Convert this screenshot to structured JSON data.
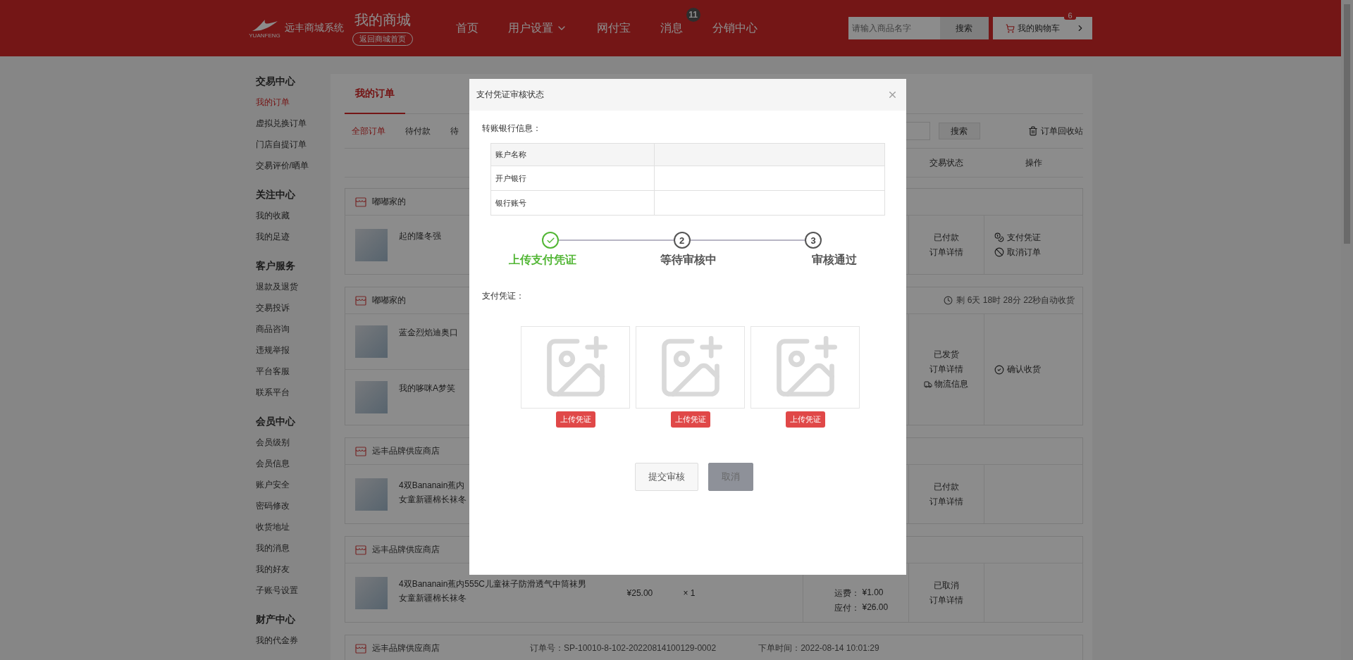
{
  "header": {
    "logo_caption": "YUANFENG",
    "brand": "远丰商城系统",
    "title": "我的商城",
    "home_link": "返回商城首页",
    "nav": [
      {
        "label": "首页",
        "dropdown": false
      },
      {
        "label": "用户设置",
        "dropdown": true
      },
      {
        "label": "网付宝",
        "dropdown": false
      },
      {
        "label": "消息",
        "dropdown": false,
        "badge": "11"
      },
      {
        "label": "分销中心",
        "dropdown": false
      }
    ],
    "search": {
      "placeholder": "请输入商品名字",
      "button": "搜索"
    },
    "cart": {
      "label": "我的购物车",
      "badge": "6"
    }
  },
  "sidebar": [
    {
      "title": "交易中心",
      "items": [
        {
          "label": "我的订单",
          "selected": true
        },
        {
          "label": "虚拟兑换订单",
          "selected": false
        },
        {
          "label": "门店自提订单",
          "selected": false
        },
        {
          "label": "交易评价/晒单",
          "selected": false
        }
      ]
    },
    {
      "title": "关注中心",
      "items": [
        {
          "label": "我的收藏",
          "selected": false
        },
        {
          "label": "我的足迹",
          "selected": false
        }
      ]
    },
    {
      "title": "客户服务",
      "items": [
        {
          "label": "退款及退货",
          "selected": false
        },
        {
          "label": "交易投诉",
          "selected": false
        },
        {
          "label": "商品咨询",
          "selected": false
        },
        {
          "label": "违规举报",
          "selected": false
        },
        {
          "label": "平台客服",
          "selected": false
        },
        {
          "label": "联系平台",
          "selected": false
        }
      ]
    },
    {
      "title": "会员中心",
      "items": [
        {
          "label": "会员级别",
          "selected": false
        },
        {
          "label": "会员信息",
          "selected": false
        },
        {
          "label": "账户安全",
          "selected": false
        },
        {
          "label": "密码修改",
          "selected": false
        },
        {
          "label": "收货地址",
          "selected": false
        },
        {
          "label": "我的消息",
          "selected": false
        },
        {
          "label": "我的好友",
          "selected": false
        },
        {
          "label": "子账号设置",
          "selected": false
        }
      ]
    },
    {
      "title": "财产中心",
      "items": [
        {
          "label": "我的代金券",
          "selected": false
        }
      ]
    }
  ],
  "orders_panel": {
    "tabs": [
      {
        "label": "我的订单",
        "selected": true
      }
    ],
    "filters": [
      {
        "label": "全部订单",
        "selected": true
      },
      {
        "label": "待付款",
        "selected": false
      },
      {
        "label": "待",
        "selected": false
      }
    ],
    "search_button": "搜索",
    "recycle_bin": "订单回收站",
    "columns": [
      "交易状态",
      "操作"
    ],
    "orders": [
      {
        "shop": "嘟嘟家的",
        "items": [
          {
            "lines": [
              "起的隆冬强"
            ]
          }
        ],
        "status": "已付款",
        "links": [
          {
            "kind": "detail",
            "label": "订单详情"
          }
        ],
        "actions": [
          {
            "kind": "voucher",
            "label": "支付凭证"
          },
          {
            "kind": "cancel",
            "label": "取消订单"
          }
        ]
      },
      {
        "shop": "嘟嘟家的",
        "countdown": "剩 6天 18时 28分 22秒自动收货",
        "items": [
          {
            "lines": [
              "蓝金烈焰迪奥口"
            ]
          },
          {
            "lines": [
              "我的哆咪A梦笑"
            ]
          }
        ],
        "status": "已发货",
        "links": [
          {
            "kind": "detail",
            "label": "订单详情"
          },
          {
            "kind": "logistics",
            "label": "物流信息"
          }
        ],
        "actions": [
          {
            "kind": "confirm",
            "label": "确认收货"
          }
        ]
      },
      {
        "shop": "远丰品牌供应商店",
        "items": [
          {
            "lines": [
              "4双Bananain蕉内",
              "女童新疆棉长袜冬"
            ]
          }
        ],
        "status": "已付款",
        "links": [
          {
            "kind": "detail",
            "label": "订单详情"
          }
        ]
      },
      {
        "shop": "远丰品牌供应商店",
        "items": [
          {
            "lines": [
              "4双Bananain蕉内555C儿童袜子防滑透气中筒袜男",
              "女童新疆棉长袜冬"
            ],
            "price": "¥25.00",
            "qty": "× 1"
          }
        ],
        "totals": [
          {
            "label": "运费：",
            "value": "¥1.00"
          },
          {
            "label": "应付：",
            "value": "¥26.00"
          }
        ],
        "status": "已取消",
        "links": [
          {
            "kind": "detail",
            "label": "订单详情"
          }
        ]
      },
      {
        "shop": "远丰品牌供应商店",
        "order_no": "订单号：SP-10010-8-102-20220814100129-0002",
        "order_time": "下单时间：2022-08-14 10:01:29"
      }
    ]
  },
  "dialog": {
    "title": "支付凭证审核状态",
    "bank_section": "转账银行信息：",
    "bank_rows": [
      {
        "kind": "header",
        "label": "账户名称"
      },
      {
        "kind": "row",
        "label": "开户银行"
      },
      {
        "kind": "row",
        "label": "银行账号"
      }
    ],
    "steps": [
      {
        "label": "上传支付凭证",
        "done": true
      },
      {
        "label": "等待审核中",
        "number": "2",
        "done": false
      },
      {
        "label": "审核通过",
        "number": "3",
        "done": false
      }
    ],
    "voucher_section": "支付凭证：",
    "uploads": [
      {
        "button": "上传凭证"
      },
      {
        "button": "上传凭证"
      },
      {
        "button": "上传凭证"
      }
    ],
    "buttons": [
      {
        "label": "提交审核",
        "kind": "default"
      },
      {
        "label": "取消",
        "kind": "muted"
      }
    ]
  }
}
